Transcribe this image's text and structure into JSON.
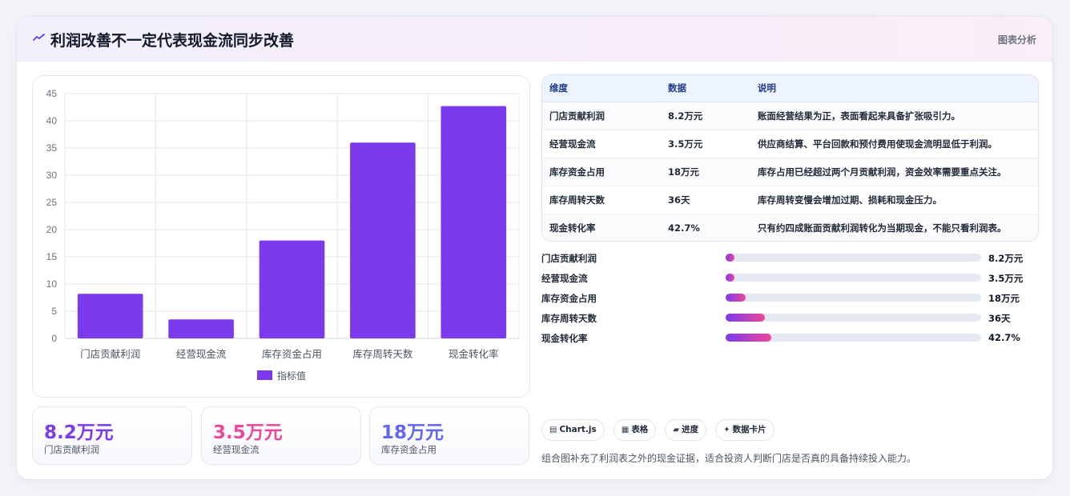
{
  "header": {
    "title": "利润改善不一定代表现金流同步改善",
    "tag": "图表分析"
  },
  "chart_data": {
    "type": "bar",
    "categories": [
      "门店贡献利润",
      "经营现金流",
      "库存资金占用",
      "库存周转天数",
      "现金转化率"
    ],
    "series": [
      {
        "name": "指标值",
        "values": [
          8.2,
          3.5,
          18,
          36,
          42.7
        ]
      }
    ],
    "ylim": [
      0,
      45
    ],
    "yticks": [
      0,
      5,
      10,
      15,
      20,
      25,
      30,
      35,
      40,
      45
    ],
    "grid": true,
    "legend": "bottom",
    "bar_color": "#7c3aed"
  },
  "stats": [
    {
      "value": "8.2万元",
      "label": "门店贡献利润",
      "color": "#7c3aed"
    },
    {
      "value": "3.5万元",
      "label": "经营现金流",
      "color": "#ec4899"
    },
    {
      "value": "18万元",
      "label": "库存资金占用",
      "color": "#6366f1"
    }
  ],
  "table": {
    "headers": [
      "维度",
      "数据",
      "说明"
    ],
    "rows": [
      [
        "门店贡献利润",
        "8.2万元",
        "账面经营结果为正，表面看起来具备扩张吸引力。"
      ],
      [
        "经营现金流",
        "3.5万元",
        "供应商结算、平台回款和预付费用使现金流明显低于利润。"
      ],
      [
        "库存资金占用",
        "18万元",
        "库存占用已经超过两个月贡献利润，资金效率需要重点关注。"
      ],
      [
        "库存周转天数",
        "36天",
        "库存周转变慢会增加过期、损耗和现金压力。"
      ],
      [
        "现金转化率",
        "42.7%",
        "只有约四成账面贡献利润转化为当期现金，不能只看利润表。"
      ]
    ]
  },
  "progress": [
    {
      "label": "门店贡献利润",
      "value_text": "8.2万元",
      "fraction": 0.03
    },
    {
      "label": "经营现金流",
      "value_text": "3.5万元",
      "fraction": 0.03
    },
    {
      "label": "库存资金占用",
      "value_text": "18万元",
      "fraction": 0.077
    },
    {
      "label": "库存周转天数",
      "value_text": "36天",
      "fraction": 0.155
    },
    {
      "label": "现金转化率",
      "value_text": "42.7%",
      "fraction": 0.18
    }
  ],
  "chips": [
    {
      "icon": "chart-icon",
      "glyph": "▤",
      "label": "Chart.js"
    },
    {
      "icon": "table-icon",
      "glyph": "▦",
      "label": "表格"
    },
    {
      "icon": "progress-icon",
      "glyph": "▰",
      "label": "进度"
    },
    {
      "icon": "card-icon",
      "glyph": "✦",
      "label": "数据卡片"
    }
  ],
  "footnote": "组合图补充了利润表之外的现金证据，适合投资人判断门店是否真的具备持续投入能力。"
}
